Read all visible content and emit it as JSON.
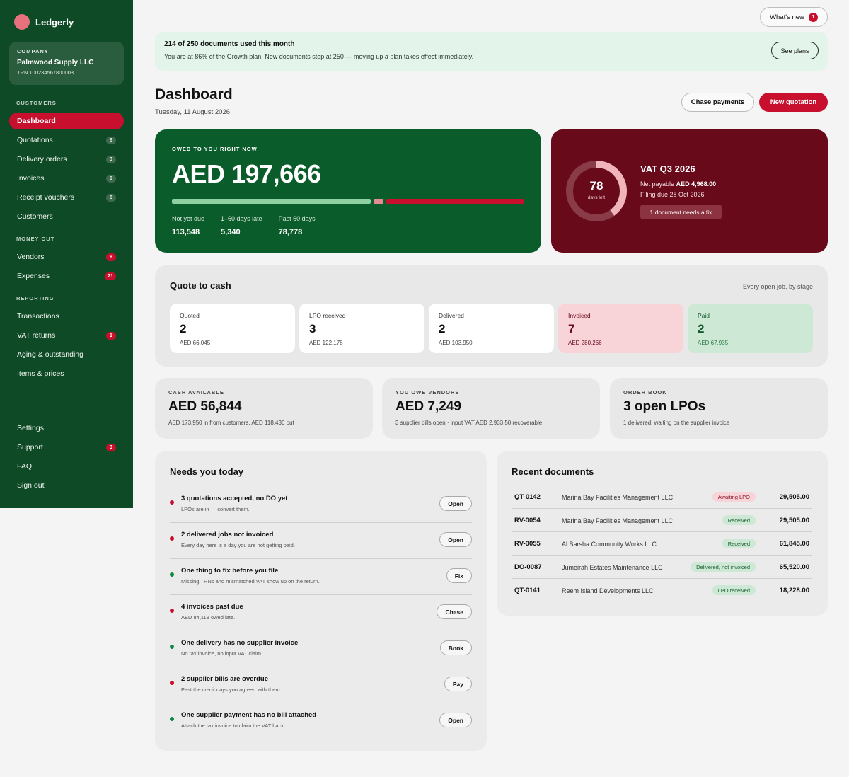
{
  "app": {
    "name": "Ledgerly"
  },
  "company": {
    "kicker": "COMPANY",
    "name": "Palmwood Supply LLC",
    "trn": "TRN 100234567800003"
  },
  "nav": {
    "sections": {
      "customers": "CUSTOMERS",
      "money_out": "MONEY OUT",
      "reporting": "REPORTING"
    },
    "customers": [
      {
        "label": "Dashboard",
        "badge": ""
      },
      {
        "label": "Quotations",
        "badge": "6"
      },
      {
        "label": "Delivery orders",
        "badge": "3"
      },
      {
        "label": "Invoices",
        "badge": "9"
      },
      {
        "label": "Receipt vouchers",
        "badge": "6"
      },
      {
        "label": "Customers",
        "badge": ""
      }
    ],
    "money_out": [
      {
        "label": "Vendors",
        "badge": "6"
      },
      {
        "label": "Expenses",
        "badge": "21"
      }
    ],
    "reporting": [
      {
        "label": "Transactions",
        "badge": ""
      },
      {
        "label": "VAT returns",
        "badge": "1"
      },
      {
        "label": "Aging & outstanding",
        "badge": ""
      },
      {
        "label": "Items & prices",
        "badge": ""
      }
    ],
    "bottom": [
      {
        "label": "Settings",
        "badge": ""
      },
      {
        "label": "Support",
        "badge": "3"
      },
      {
        "label": "FAQ",
        "badge": ""
      },
      {
        "label": "Sign out",
        "badge": ""
      }
    ]
  },
  "topbar": {
    "whats_new": "What's new",
    "whats_new_count": "1"
  },
  "banner": {
    "title": "214 of 250 documents used this month",
    "subtitle": "You are at 86% of the Growth plan. New documents stop at 250 — moving up a plan takes effect immediately.",
    "button": "See plans"
  },
  "header": {
    "title": "Dashboard",
    "date": "Tuesday, 11 August 2026",
    "chase_label": "Chase payments",
    "new_label": "New quotation"
  },
  "owed": {
    "kicker": "OWED TO YOU RIGHT NOW",
    "amount": "AED 197,666",
    "segments": [
      {
        "label": "Not yet due",
        "value": "113,548",
        "amount": 113548,
        "color": "#8fd0a0"
      },
      {
        "label": "1–60 days late",
        "value": "5,340",
        "amount": 5340,
        "color": "#e58b94"
      },
      {
        "label": "Past 60 days",
        "value": "78,778",
        "amount": 78778,
        "color": "#c8102e"
      }
    ]
  },
  "vat": {
    "title": "VAT Q3 2026",
    "days_left": "78",
    "days_left_label": "days left",
    "progress_fraction": 0.4,
    "net_payable_label": "Net payable",
    "net_payable_value": "AED 4,968.00",
    "filing_due": "Filing due 28 Oct 2026",
    "chip": "1 document needs a fix"
  },
  "quote_to_cash": {
    "title": "Quote to cash",
    "subtitle": "Every open job, by stage",
    "stages": [
      {
        "name": "Quoted",
        "count": "2",
        "amount": "AED 66,045"
      },
      {
        "name": "LPO received",
        "count": "3",
        "amount": "AED 122,178"
      },
      {
        "name": "Delivered",
        "count": "2",
        "amount": "AED 103,950"
      },
      {
        "name": "Invoiced",
        "count": "7",
        "amount": "AED 280,266"
      },
      {
        "name": "Paid",
        "count": "2",
        "amount": "AED 67,935"
      }
    ]
  },
  "kpis": [
    {
      "kicker": "CASH AVAILABLE",
      "value": "AED 56,844",
      "sub": "AED 173,950 in from customers, AED 118,436 out"
    },
    {
      "kicker": "YOU OWE VENDORS",
      "value": "AED 7,249",
      "sub": "3 supplier bills open · input VAT AED 2,933.50 recoverable"
    },
    {
      "kicker": "ORDER BOOK",
      "value": "3 open LPOs",
      "sub": "1 delivered, waiting on the supplier invoice"
    }
  ],
  "needs": {
    "title": "Needs you today",
    "tasks": [
      {
        "title": "3 quotations accepted, no DO yet",
        "sub": "LPOs are in — convert them.",
        "action": "Open",
        "color": "#c8102e"
      },
      {
        "title": "2 delivered jobs not invoiced",
        "sub": "Every day here is a day you are not getting paid.",
        "action": "Open",
        "color": "#c8102e"
      },
      {
        "title": "One thing to fix before you file",
        "sub": "Missing TRNs and mismatched VAT show up on the return.",
        "action": "Fix",
        "color": "#0b8a3e"
      },
      {
        "title": "4 invoices past due",
        "sub": "AED 84,118 owed late.",
        "action": "Chase",
        "color": "#c8102e"
      },
      {
        "title": "One delivery has no supplier invoice",
        "sub": "No tax invoice, no input VAT claim.",
        "action": "Book",
        "color": "#0b8a3e"
      },
      {
        "title": "2 supplier bills are overdue",
        "sub": "Past the credit days you agreed with them.",
        "action": "Pay",
        "color": "#c8102e"
      },
      {
        "title": "One supplier payment has no bill attached",
        "sub": "Attach the tax invoice to claim the VAT back.",
        "action": "Open",
        "color": "#0b8a3e"
      }
    ]
  },
  "recent": {
    "title": "Recent documents",
    "docs": [
      {
        "id": "QT-0142",
        "name": "Marina Bay Facilities Management LLC",
        "status": "Awaiting LPO",
        "tone": "pink",
        "amount": "29,505.00"
      },
      {
        "id": "RV-0054",
        "name": "Marina Bay Facilities Management LLC",
        "status": "Received",
        "tone": "green",
        "amount": "29,505.00"
      },
      {
        "id": "RV-0055",
        "name": "Al Barsha Community Works LLC",
        "status": "Received",
        "tone": "green",
        "amount": "61,845.00"
      },
      {
        "id": "DO-0087",
        "name": "Jumeirah Estates Maintenance LLC",
        "status": "Delivered, not invoiced",
        "tone": "green",
        "amount": "65,520.00"
      },
      {
        "id": "QT-0141",
        "name": "Reem Island Developments LLC",
        "status": "LPO received",
        "tone": "green",
        "amount": "18,228.00"
      }
    ]
  }
}
